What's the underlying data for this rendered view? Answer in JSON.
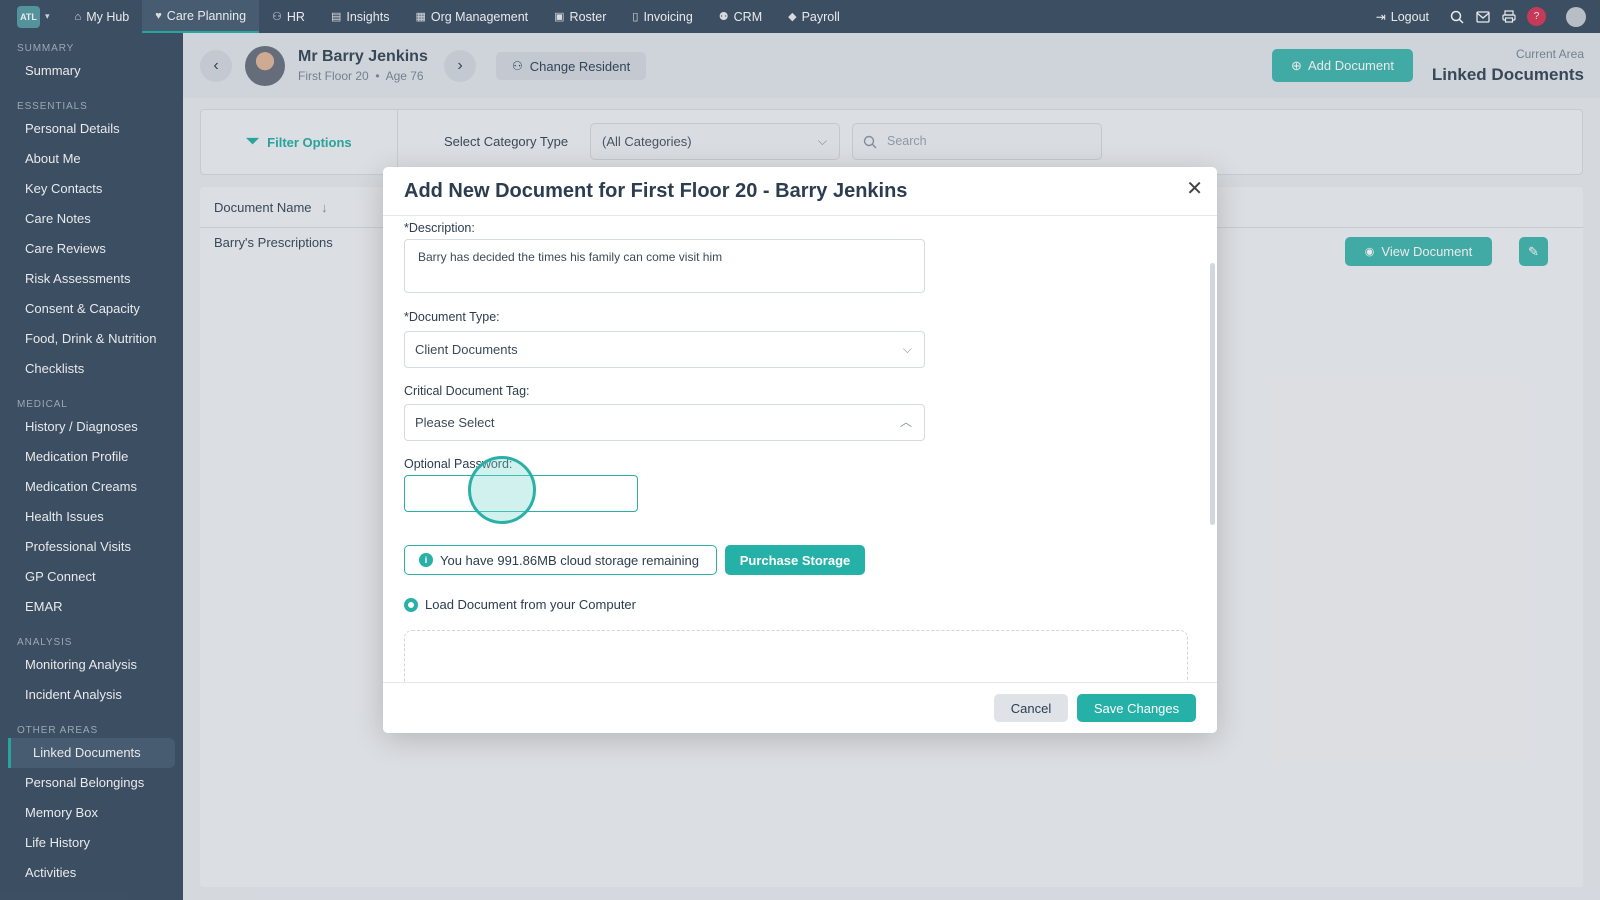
{
  "topnav": {
    "brand": "ATL",
    "items": [
      {
        "label": "My Hub",
        "icon": "home-icon"
      },
      {
        "label": "Care Planning",
        "icon": "heart-icon"
      },
      {
        "label": "HR",
        "icon": "people-icon"
      },
      {
        "label": "Insights",
        "icon": "chart-icon"
      },
      {
        "label": "Org Management",
        "icon": "building-icon"
      },
      {
        "label": "Roster",
        "icon": "calendar-icon"
      },
      {
        "label": "Invoicing",
        "icon": "document-icon"
      },
      {
        "label": "CRM",
        "icon": "users-icon"
      },
      {
        "label": "Payroll",
        "icon": "tag-icon"
      }
    ],
    "active": "Care Planning",
    "logout": "Logout",
    "help": "?"
  },
  "sidebar": {
    "sections": [
      {
        "title": "SUMMARY",
        "items": [
          "Summary"
        ]
      },
      {
        "title": "ESSENTIALS",
        "items": [
          "Personal Details",
          "About Me",
          "Key Contacts",
          "Care Notes",
          "Care Reviews",
          "Risk Assessments",
          "Consent & Capacity",
          "Food, Drink & Nutrition",
          "Checklists"
        ]
      },
      {
        "title": "MEDICAL",
        "items": [
          "History / Diagnoses",
          "Medication Profile",
          "Medication Creams",
          "Health Issues",
          "Professional Visits",
          "GP Connect",
          "EMAR"
        ]
      },
      {
        "title": "ANALYSIS",
        "items": [
          "Monitoring Analysis",
          "Incident Analysis"
        ]
      },
      {
        "title": "OTHER AREAS",
        "items": [
          "Linked Documents",
          "Personal Belongings",
          "Memory Box",
          "Life History",
          "Activities"
        ]
      }
    ],
    "active": "Linked Documents"
  },
  "resident": {
    "name": "Mr Barry Jenkins",
    "location": "First Floor 20",
    "age": "Age 76",
    "change_label": "Change Resident"
  },
  "header": {
    "add_document": "Add Document",
    "current_area_label": "Current Area",
    "current_area": "Linked Documents"
  },
  "filters": {
    "label": "Filter Options",
    "category_label": "Select Category Type",
    "category_value": "(All Categories)",
    "search_placeholder": "Search"
  },
  "table": {
    "column": "Document Name",
    "rows": [
      {
        "name": "Barry's Prescriptions",
        "view": "View Document"
      }
    ]
  },
  "modal": {
    "title": "Add New Document for First Floor 20 - Barry Jenkins",
    "description_label": "*Description:",
    "description_value": "Barry has decided the times his family can come visit him",
    "doctype_label": "*Document Type:",
    "doctype_value": "Client Documents",
    "tag_label": "Critical Document Tag:",
    "tag_value": "Please Select",
    "password_label": "Optional Password:",
    "password_value": "",
    "storage_text": "You have 991.86MB cloud storage remaining",
    "purchase_label": "Purchase Storage",
    "load_label": "Load Document from your Computer",
    "cancel": "Cancel",
    "save": "Save Changes"
  },
  "colors": {
    "accent": "#25b1a7",
    "nav_bg": "#3e5267",
    "help": "#d83b5b"
  }
}
